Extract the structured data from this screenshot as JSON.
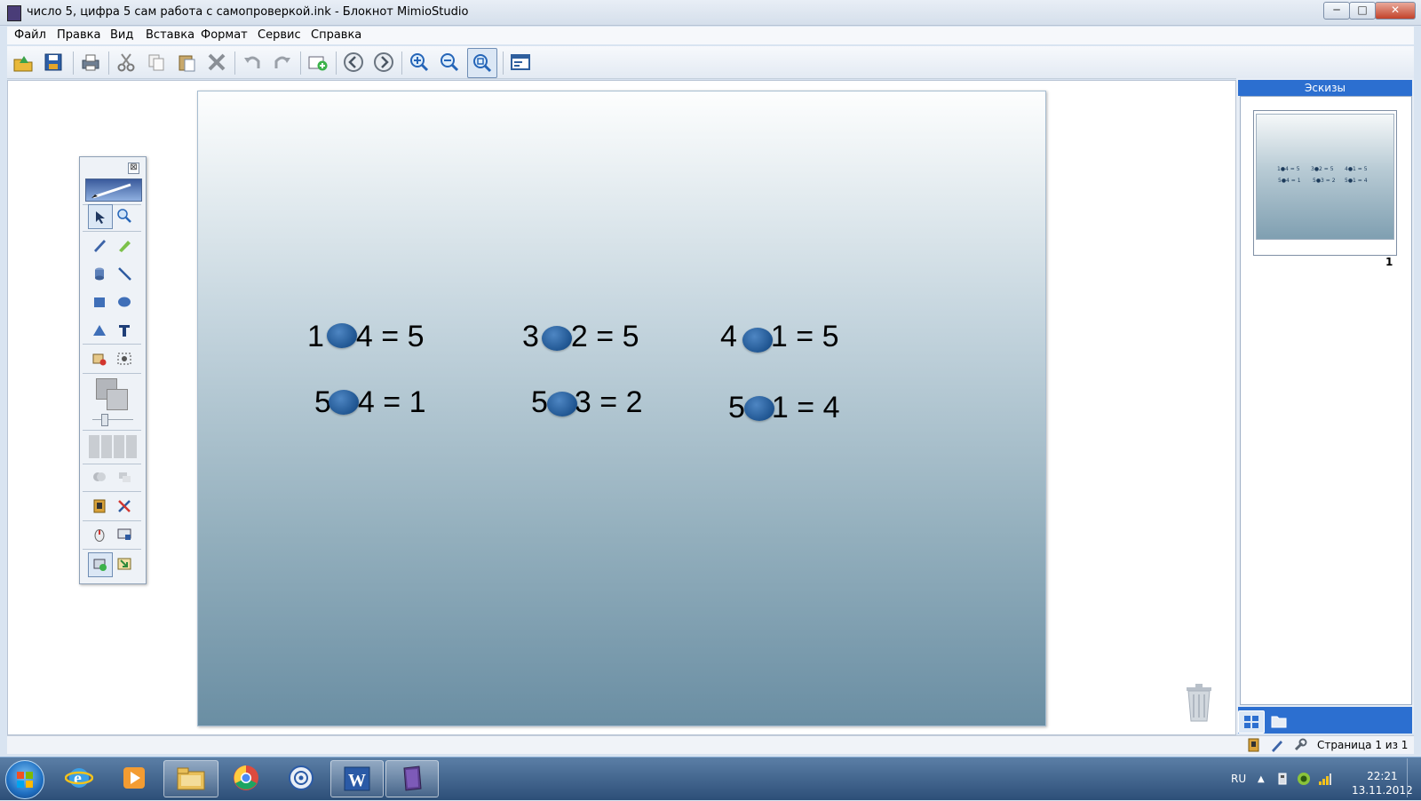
{
  "window": {
    "title": "число 5, цифра 5 сам работа с самопроверкой.ink - Блокнот MimioStudio",
    "min": "─",
    "max": "□",
    "close": "✕"
  },
  "menu": [
    {
      "label": "Файл"
    },
    {
      "label": "Правка"
    },
    {
      "label": "Вид"
    },
    {
      "label": "Вставка"
    },
    {
      "label": "Формат"
    },
    {
      "label": "Сервис"
    },
    {
      "label": "Справка"
    }
  ],
  "slide": {
    "equations": [
      {
        "left": "1",
        "right": "4 = 5"
      },
      {
        "left": "3",
        "right": "2 = 5"
      },
      {
        "left": "4",
        "right": "1 = 5"
      },
      {
        "left": "5",
        "right": "4 = 1"
      },
      {
        "left": "5",
        "right": "3 = 2"
      },
      {
        "left": "5",
        "right": "1 = 4"
      }
    ]
  },
  "palette": {
    "close": "⊠"
  },
  "right_panel": {
    "title": "Эскизы",
    "thumb_number": "1",
    "thumb_lines": [
      "1●4 = 5",
      "3●2 = 5",
      "4●1 = 5",
      "5●4 = 1",
      "5●3 = 2",
      "5●1 = 4"
    ]
  },
  "status": {
    "page": "Страница 1 из 1"
  },
  "taskbar": {
    "lang": "RU",
    "time": "22:21",
    "date": "13.11.2012"
  }
}
